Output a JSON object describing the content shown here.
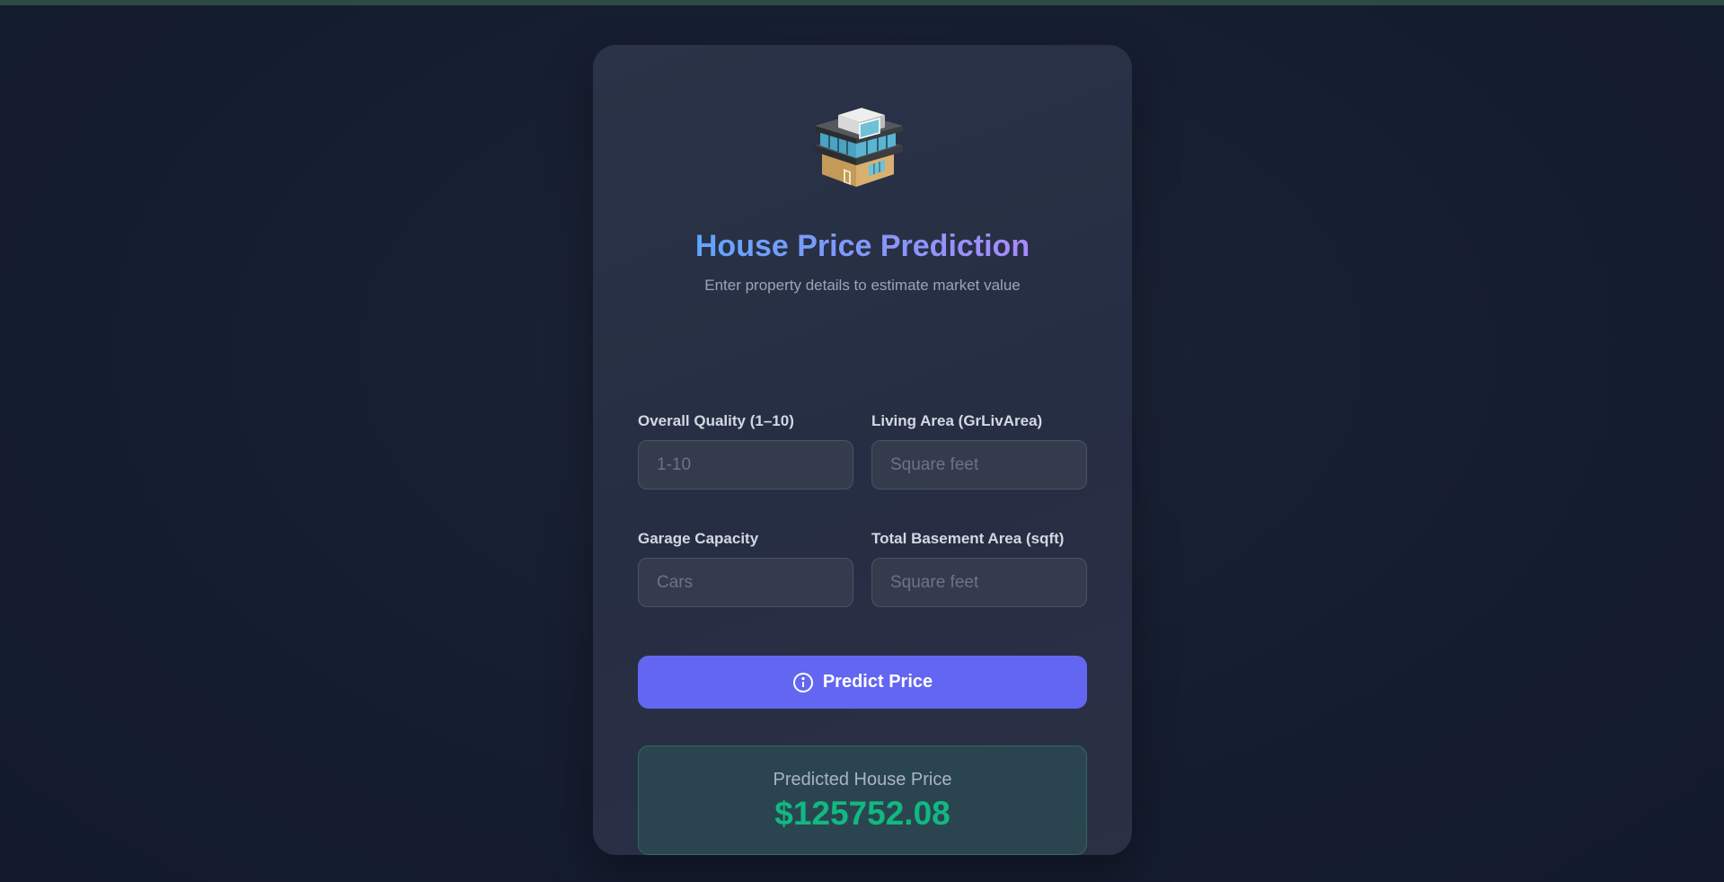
{
  "app": {
    "title": "House Price Prediction",
    "subtitle": "Enter property details to estimate market value",
    "logo_icon": "house-icon"
  },
  "form": {
    "fields": [
      {
        "label": "Overall Quality (1–10)",
        "placeholder": "1-10",
        "value": ""
      },
      {
        "label": "Living Area (GrLivArea)",
        "placeholder": "Square feet",
        "value": ""
      },
      {
        "label": "Garage Capacity",
        "placeholder": "Cars",
        "value": ""
      },
      {
        "label": "Total Basement Area (sqft)",
        "placeholder": "Square feet",
        "value": ""
      }
    ],
    "submit_label": "Predict Price",
    "submit_icon": "info-circle-icon"
  },
  "result": {
    "label": "Predicted House Price",
    "value": "$125752.08"
  },
  "colors": {
    "accent": "#6366f1",
    "success": "#10b981",
    "title_gradient_start": "#60a5fa",
    "title_gradient_end": "#a78bfa"
  }
}
